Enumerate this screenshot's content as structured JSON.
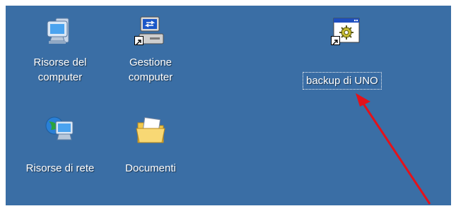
{
  "desktop": {
    "background": "#3a6ea5",
    "icons": [
      {
        "label": "Risorse del\ncomputer",
        "icon": "my-computer-icon"
      },
      {
        "label": "Gestione\ncomputer",
        "icon": "computer-management-icon"
      },
      {
        "label": "Risorse di rete",
        "icon": "network-places-icon"
      },
      {
        "label": "Documenti",
        "icon": "my-documents-folder-icon"
      },
      {
        "label": "backup di UNO",
        "icon": "batch-shortcut-icon",
        "selected": true
      }
    ]
  },
  "annotation": {
    "arrow_color": "#e3121b"
  }
}
